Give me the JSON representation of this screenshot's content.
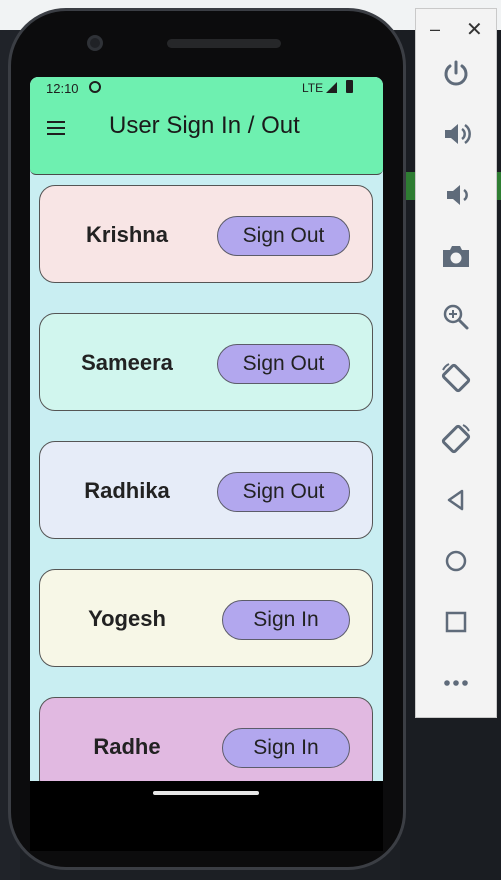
{
  "status_bar": {
    "time": "12:10",
    "network": "LTE"
  },
  "app": {
    "title": "User Sign In / Out"
  },
  "users": [
    {
      "name": "Krishna",
      "action": "Sign Out",
      "color": "#f8e5e5"
    },
    {
      "name": "Sameera",
      "action": "Sign Out",
      "color": "#d1f6ee"
    },
    {
      "name": "Radhika",
      "action": "Sign Out",
      "color": "#e6ecf8"
    },
    {
      "name": "Yogesh",
      "action": "Sign In",
      "color": "#f7f7e7"
    },
    {
      "name": "Radhe",
      "action": "Sign In",
      "color": "#e1b9e1"
    }
  ],
  "colors": {
    "app_bar": "#6ef0b0",
    "screen_bg": "#c9eef2",
    "button": "#b2a7ee"
  },
  "emulator_panel": {
    "tools": [
      "power-icon",
      "volume-up-icon",
      "volume-down-icon",
      "camera-icon",
      "zoom-icon",
      "rotate-left-icon",
      "rotate-right-icon",
      "back-icon",
      "home-icon",
      "overview-icon",
      "more-icon"
    ]
  }
}
